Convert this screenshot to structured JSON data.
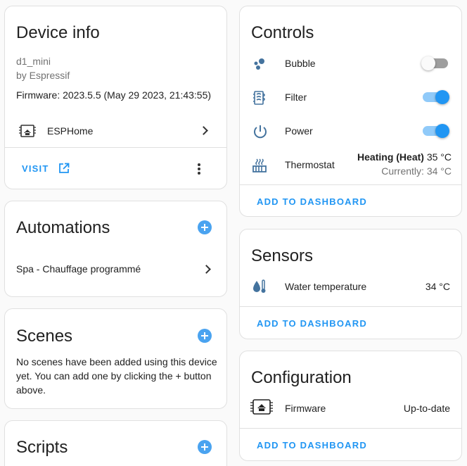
{
  "device_info": {
    "title": "Device info",
    "model": "d1_mini",
    "manufacturer": "by Espressif",
    "firmware": "Firmware: 2023.5.5 (May 29 2023, 21:43:55)",
    "integration_label": "ESPHome",
    "visit_label": "VISIT"
  },
  "automations": {
    "title": "Automations",
    "items": [
      {
        "label": "Spa - Chauffage programmé"
      }
    ]
  },
  "scenes": {
    "title": "Scenes",
    "empty_text_1": "No scenes have been added using this device",
    "empty_text_2": "yet. You can add one by clicking the + button",
    "empty_text_3": "above."
  },
  "scripts": {
    "title": "Scripts"
  },
  "controls": {
    "title": "Controls",
    "items": [
      {
        "label": "Bubble",
        "state": "off"
      },
      {
        "label": "Filter",
        "state": "on"
      },
      {
        "label": "Power",
        "state": "on"
      },
      {
        "label": "Thermostat",
        "mode": "Heating (Heat)",
        "target": "35 °C",
        "current": "Currently: 34 °C"
      }
    ],
    "add_label": "ADD TO DASHBOARD"
  },
  "sensors": {
    "title": "Sensors",
    "items": [
      {
        "label": "Water temperature",
        "value": "34 °C"
      }
    ],
    "add_label": "ADD TO DASHBOARD"
  },
  "configuration": {
    "title": "Configuration",
    "items": [
      {
        "label": "Firmware",
        "value": "Up-to-date"
      }
    ],
    "add_label": "ADD TO DASHBOARD"
  },
  "colors": {
    "accent": "#2196f3",
    "icon": "#44739e",
    "toggle_track_on": "#90caf9",
    "toggle_off": "#9e9e9e"
  }
}
